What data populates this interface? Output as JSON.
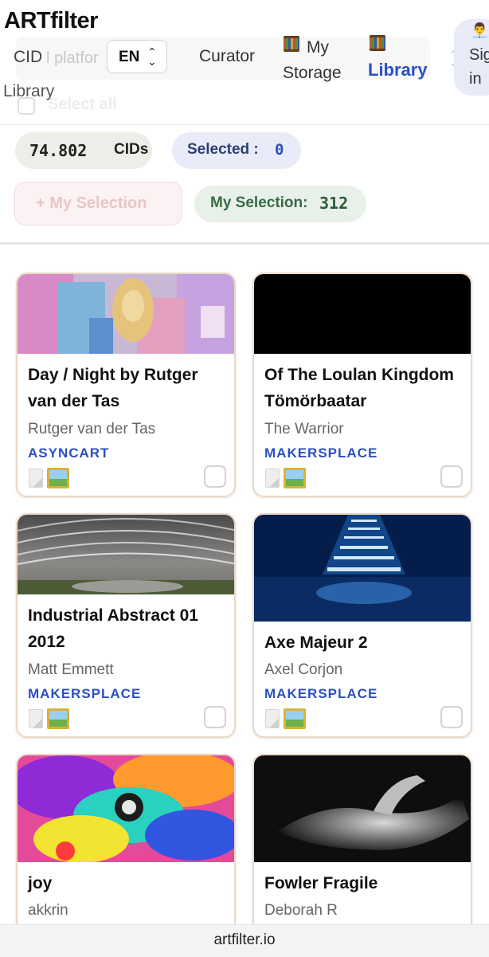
{
  "header": {
    "brand": "ARTfilter",
    "cid_label": "CID",
    "cid_placeholder": "l platfor",
    "language": "EN",
    "nav": {
      "curator": "Curator",
      "storage_line1": "My",
      "storage_line2": "Storage",
      "library": "Library"
    },
    "signin_line1": "Sig",
    "signin_line2": "in",
    "section_title": "Library",
    "select_all": "Select all"
  },
  "stats": {
    "cids_count": "74.802",
    "cids_label": "CIDs",
    "selected_label": "Selected :",
    "selected_count": "0",
    "add_selection": "+ My Selection",
    "my_selection_label": "My Selection:",
    "my_selection_count": "312"
  },
  "cards": [
    {
      "title": "Day / Night by Rutger van der Tas",
      "artist": "Rutger van der Tas",
      "platform": "ASYNCART",
      "checked": false
    },
    {
      "title": "Of The Loulan Kingdom Tömörbaatar",
      "artist": "The Warrior",
      "platform": "MAKERSPLACE",
      "checked": false
    },
    {
      "title": "Industrial Abstract 01 2012",
      "artist": "Matt Emmett",
      "platform": "MAKERSPLACE",
      "checked": false
    },
    {
      "title": "Axe Majeur 2",
      "artist": "Axel Corjon",
      "platform": "MAKERSPLACE",
      "checked": false
    },
    {
      "title": "joy",
      "artist": "akkrin",
      "platform": "",
      "checked": false
    },
    {
      "title": "Fowler Fragile",
      "artist": "Deborah R",
      "platform": "",
      "checked": false
    }
  ],
  "footer": {
    "domain": "artfilter.io"
  },
  "colors": {
    "accent": "#2b4fc4",
    "selection_green": "#2f5a39",
    "card_border": "#ecd9c6"
  },
  "icons": [
    "chevron-updown-icon",
    "library-shelf-icon",
    "user-avatar-icon",
    "document-icon",
    "image-icon",
    "checkbox-icon"
  ]
}
